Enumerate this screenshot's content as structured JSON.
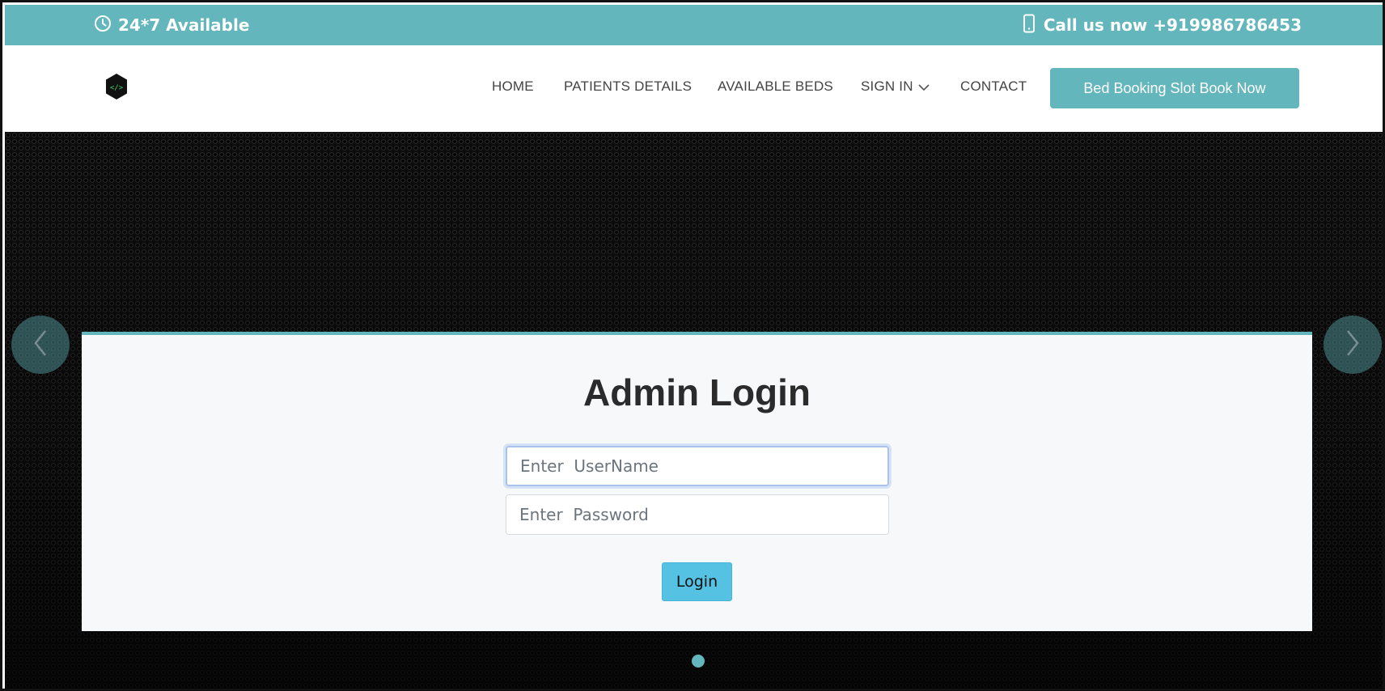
{
  "topbar": {
    "availability_text": "24*7 Available",
    "availability_icon": "clock-icon",
    "call_text": "Call us now +919986786453",
    "call_icon": "mobile-phone-icon"
  },
  "header": {
    "logo_icon": "code-hexagon-logo",
    "nav": [
      {
        "label": "HOME"
      },
      {
        "label": "PATIENTS DETAILS"
      },
      {
        "label": "AVAILABLE BEDS"
      },
      {
        "label": "SIGN IN",
        "has_dropdown": true
      },
      {
        "label": "CONTACT"
      }
    ],
    "cta_label": "Bed Booking Slot Book Now"
  },
  "login": {
    "title": "Admin Login",
    "username_placeholder": "Enter  UserName",
    "password_placeholder": "Enter  Password",
    "button_label": "Login"
  },
  "carousel": {
    "prev_icon": "chevron-left-icon",
    "next_icon": "chevron-right-icon",
    "slides_count": 1,
    "active_slide": 1
  },
  "colors": {
    "accent": "#62b6bc",
    "login_button": "#55c2e4",
    "title_text": "#2b2b2b",
    "nav_text": "#444444"
  }
}
